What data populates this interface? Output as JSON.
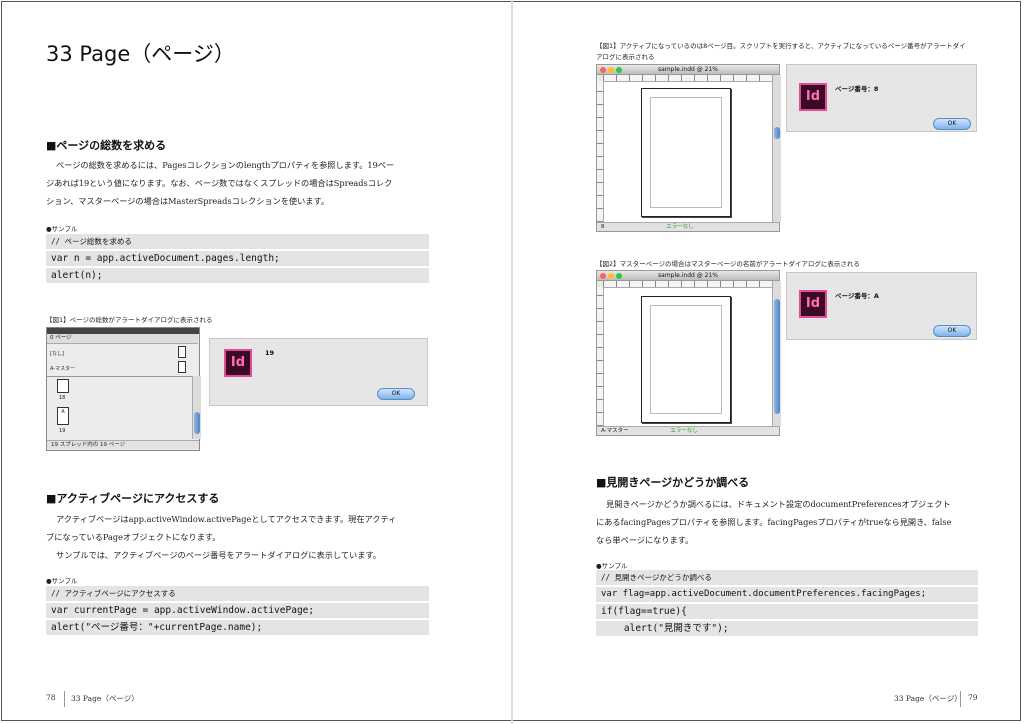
{
  "left_page": {
    "title": "33 Page（ページ）",
    "sec1": {
      "heading": "■ページの総数を求める",
      "paragraph": [
        "ページの総数を求めるには、Pagesコレクションのlengthプロパティを参照します。19ペー",
        "ジあれば19という値になります。なお、ページ数ではなくスプレッドの場合はSpreadsコレク",
        "ション、マスターページの場合はMasterSpreadsコレクションを使います。"
      ],
      "sample_label": "●サンプル",
      "code": [
        "// ページ総数を求める",
        "var n = app.activeDocument.pages.length;",
        "alert(n);"
      ],
      "figure_caption": "【図1】ページの総数がアラートダイアログに表示される",
      "dialog_message": "19",
      "ok_label": "OK",
      "panel": {
        "tab": "0 ページ",
        "none_row": "[なし]",
        "master_row": "A-マスター",
        "page_numbers": [
          "18",
          "19"
        ],
        "master_letter": "A",
        "status": "19 スプレッド内の 19 ページ"
      }
    },
    "sec2": {
      "heading": "■アクティブページにアクセスする",
      "paragraph": [
        "アクティブページはapp.activeWindow.activePageとしてアクセスできます。現在アクティ",
        "ブになっているPageオブジェクトになります。",
        "サンプルでは、アクティブページのページ番号をアラートダイアログに表示しています。"
      ],
      "sample_label": "●サンプル",
      "code": [
        "// アクティブページにアクセスする",
        "var currentPage = app.activeWindow.activePage;",
        "alert(\"ページ番号：\"+currentPage.name);"
      ]
    },
    "footer": {
      "page_number": "78",
      "running_title": "33 Page（ページ）"
    }
  },
  "right_page": {
    "fig1": {
      "caption": [
        "【図1】アクティブになっているのは8ページ目。スクリプトを実行すると、アクティブになっているページ番号がアラートダイ",
        "アログに表示される"
      ],
      "window_title": "sample.indd @ 21%",
      "dialog_message": "ページ番号：8",
      "ok_label": "OK",
      "status_left": "8",
      "status_right": "エラーなし"
    },
    "fig2": {
      "caption": "【図2】マスターページの場合はマスターページの名前がアラートダイアログに表示される",
      "window_title": "sample.indd @ 21%",
      "dialog_message": "ページ番号：A",
      "ok_label": "OK",
      "status_left": "A-マスター",
      "status_right": "エラーなし"
    },
    "sec3": {
      "heading": "■見開きページかどうか調べる",
      "paragraph": [
        "見開きページかどうか調べるには、ドキュメント設定のdocumentPreferencesオブジェクト",
        "にあるfacingPagesプロパティを参照します。facingPagesプロパティがtrueなら見開き、false",
        "なら単ページになります。"
      ],
      "sample_label": "●サンプル",
      "code": [
        "// 見開きページかどうか調べる",
        "var flag=app.activeDocument.documentPreferences.facingPages;",
        "if(flag==true){",
        "    alert(\"見開きです\");"
      ]
    },
    "footer": {
      "page_number": "79",
      "running_title": "33 Page（ページ）"
    }
  },
  "icons": [
    "indesign-app-icon"
  ]
}
